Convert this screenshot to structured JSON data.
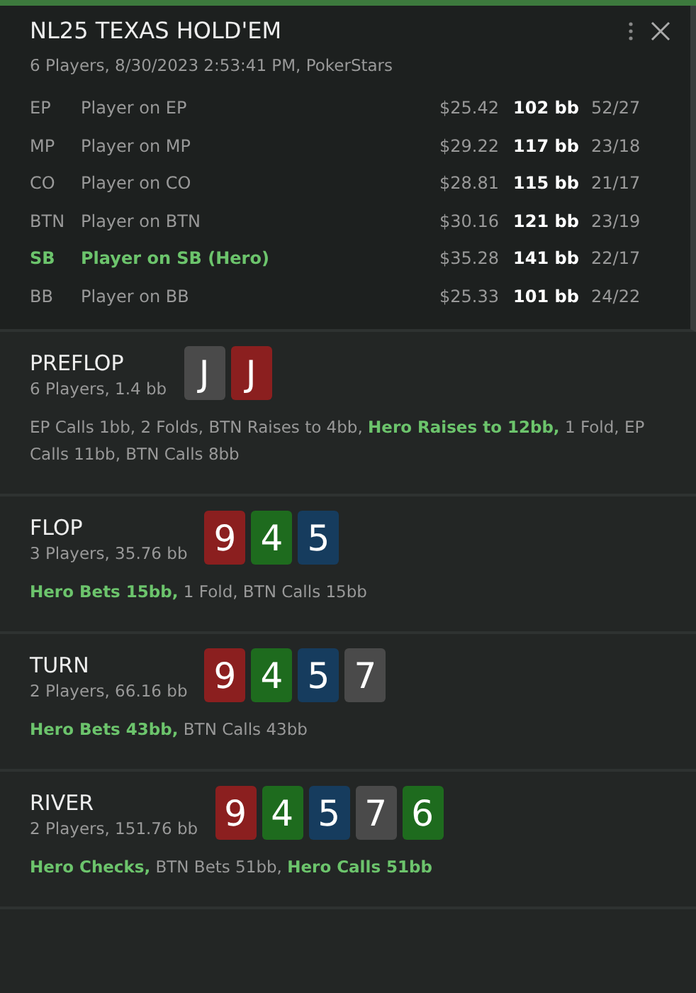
{
  "header": {
    "title": "NL25 TEXAS HOLD'EM",
    "subtitle": "6 Players, 8/30/2023 2:53:41 PM, PokerStars"
  },
  "players": [
    {
      "position": "EP",
      "name": "Player on EP",
      "stack": "$25.42",
      "bb": "102 bb",
      "stats": "52/27",
      "hero": false
    },
    {
      "position": "MP",
      "name": "Player on MP",
      "stack": "$29.22",
      "bb": "117 bb",
      "stats": "23/18",
      "hero": false
    },
    {
      "position": "CO",
      "name": "Player on CO",
      "stack": "$28.81",
      "bb": "115 bb",
      "stats": "21/17",
      "hero": false
    },
    {
      "position": "BTN",
      "name": "Player on BTN",
      "stack": "$30.16",
      "bb": "121 bb",
      "stats": "23/19",
      "hero": false
    },
    {
      "position": "SB",
      "name": "Player on SB (Hero)",
      "stack": "$35.28",
      "bb": "141 bb",
      "stats": "22/17",
      "hero": true
    },
    {
      "position": "BB",
      "name": "Player on BB",
      "stack": "$25.33",
      "bb": "101 bb",
      "stats": "24/22",
      "hero": false
    }
  ],
  "streets": [
    {
      "name": "PREFLOP",
      "info": "6 Players, 1.4 bb",
      "cards": [
        {
          "rank": "J",
          "color": "#4a4a4a"
        },
        {
          "rank": "J",
          "color": "#8b1f1f"
        }
      ],
      "actions": [
        {
          "text": "EP Calls 1bb, 2 Folds, BTN Raises to 4bb, ",
          "hero": false
        },
        {
          "text": "Hero Raises to 12bb,",
          "hero": true
        },
        {
          "text": " 1 Fold, EP Calls 11bb, BTN Calls 8bb",
          "hero": false
        }
      ]
    },
    {
      "name": "FLOP",
      "info": "3 Players, 35.76 bb",
      "cards": [
        {
          "rank": "9",
          "color": "#8b1f1f"
        },
        {
          "rank": "4",
          "color": "#1e6b1e"
        },
        {
          "rank": "5",
          "color": "#163c5e"
        }
      ],
      "actions": [
        {
          "text": "Hero Bets 15bb,",
          "hero": true
        },
        {
          "text": " 1 Fold, BTN Calls 15bb",
          "hero": false
        }
      ]
    },
    {
      "name": "TURN",
      "info": "2 Players, 66.16 bb",
      "cards": [
        {
          "rank": "9",
          "color": "#8b1f1f"
        },
        {
          "rank": "4",
          "color": "#1e6b1e"
        },
        {
          "rank": "5",
          "color": "#163c5e"
        },
        {
          "rank": "7",
          "color": "#4a4a4a"
        }
      ],
      "actions": [
        {
          "text": "Hero Bets 43bb,",
          "hero": true
        },
        {
          "text": " BTN Calls 43bb",
          "hero": false
        }
      ]
    },
    {
      "name": "RIVER",
      "info": "2 Players, 151.76 bb",
      "cards": [
        {
          "rank": "9",
          "color": "#8b1f1f"
        },
        {
          "rank": "4",
          "color": "#1e6b1e"
        },
        {
          "rank": "5",
          "color": "#163c5e"
        },
        {
          "rank": "7",
          "color": "#4a4a4a"
        },
        {
          "rank": "6",
          "color": "#1e6b1e"
        }
      ],
      "actions": [
        {
          "text": "Hero Checks,",
          "hero": true
        },
        {
          "text": " BTN Bets 51bb, ",
          "hero": false
        },
        {
          "text": "Hero Calls 51bb",
          "hero": true
        }
      ]
    }
  ]
}
